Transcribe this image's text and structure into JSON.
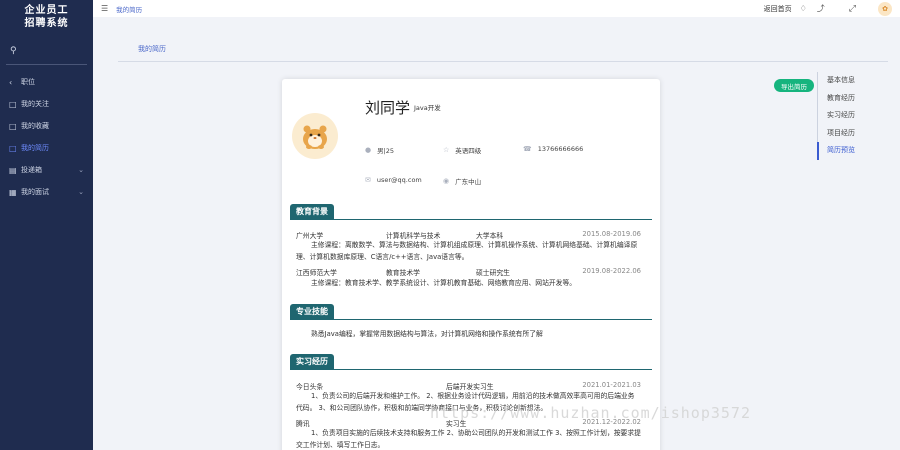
{
  "sidebar": {
    "logo_line1": "企业员工",
    "logo_line2": "招聘系统",
    "items": [
      {
        "label": "职位",
        "icon": "chevron-left-icon"
      },
      {
        "label": "我的关注",
        "icon": "doc-icon"
      },
      {
        "label": "我的收藏",
        "icon": "doc-icon"
      },
      {
        "label": "我的简历",
        "icon": "doc-icon"
      },
      {
        "label": "投递箱",
        "icon": "box-icon"
      },
      {
        "label": "我的面试",
        "icon": "calendar-icon"
      }
    ]
  },
  "topbar": {
    "breadcrumb": "我的简历",
    "home_link": "返回首页"
  },
  "page": {
    "title": "我的简历",
    "export_button": "导出简历"
  },
  "anchors": [
    "基本信息",
    "教育经历",
    "实习经历",
    "项目经历",
    "简历预览"
  ],
  "profile": {
    "name": "刘同学",
    "job": "Java开发",
    "gender_age": "男|25",
    "english": "英语四级",
    "phone": "13766666666",
    "email": "user@qq.com",
    "location": "广东中山"
  },
  "sections": {
    "education": "教育背景",
    "skills": "专业技能",
    "internship": "实习经历"
  },
  "education": [
    {
      "school": "广州大学",
      "major": "计算机科学与技术",
      "degree": "大学本科",
      "period": "2015.08-2019.06",
      "courses": "主修课程：离散数学、算法与数据结构、计算机组成原理、计算机操作系统、计算机网络基础、计算机编译原理、计算机数据库原理、C语言/c++语言、Java语言等。"
    },
    {
      "school": "江西师范大学",
      "major": "教育技术学",
      "degree": "硕士研究生",
      "period": "2019.08-2022.06",
      "courses": "主修课程：教育技术学、教学系统设计、计算机教育基础、网络教育应用、网站开发等。"
    }
  ],
  "skills_text": "熟悉Java编程，掌握常用数据结构与算法，对计算机网络和操作系统有所了解",
  "internship": [
    {
      "company": "今日头条",
      "role": "后端开发实习生",
      "period": "2021.01-2021.03",
      "desc": "1、负责公司的后端开发和维护工作。 2、根据业务设计代码逻辑，用前沿的技术做高效率高可用的后端业务代码。 3、和公司团队协作，积极和前端同学协商接口与业务，积极讨论创新想法。"
    },
    {
      "company": "腾讯",
      "role": "实习生",
      "period": "2021.12-2022.02",
      "desc": "1、负责项目实施的后续技术支持和服务工作 2、协助公司团队的开发和测试工作 3、按照工作计划，按要求提交工作计划、填写工作日志。"
    }
  ],
  "watermark": "https://www.huzhan.com/ishop3572",
  "colors": {
    "sidebar_bg": "#1f2c4f",
    "section_teal": "#1f6670",
    "export_green": "#16b47e",
    "accent_blue": "#3a5bd0"
  }
}
